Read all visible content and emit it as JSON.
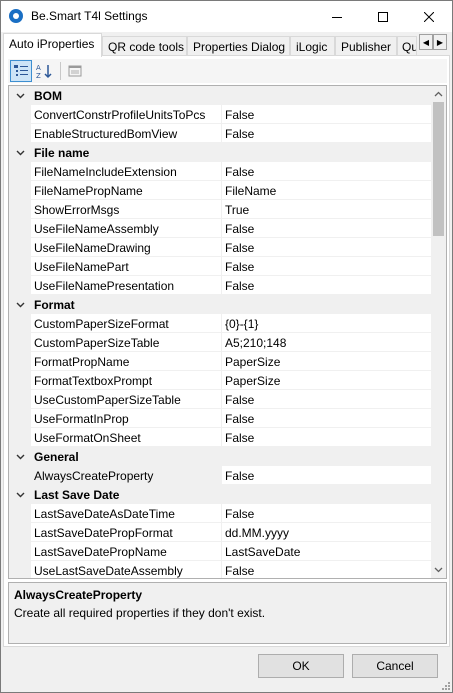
{
  "window": {
    "title": "Be.Smart T4l Settings"
  },
  "tabs": [
    {
      "label": "Auto iProperties"
    },
    {
      "label": "QR code tools"
    },
    {
      "label": "Properties Dialog"
    },
    {
      "label": "iLogic"
    },
    {
      "label": "Publisher"
    },
    {
      "label": "Qu"
    }
  ],
  "grid": {
    "categories": [
      {
        "name": "BOM",
        "properties": [
          {
            "name": "ConvertConstrProfileUnitsToPcs",
            "value": "False"
          },
          {
            "name": "EnableStructuredBomView",
            "value": "False"
          }
        ]
      },
      {
        "name": "File name",
        "properties": [
          {
            "name": "FileNameIncludeExtension",
            "value": "False"
          },
          {
            "name": "FileNamePropName",
            "value": "FileName"
          },
          {
            "name": "ShowErrorMsgs",
            "value": "True"
          },
          {
            "name": "UseFileNameAssembly",
            "value": "False"
          },
          {
            "name": "UseFileNameDrawing",
            "value": "False"
          },
          {
            "name": "UseFileNamePart",
            "value": "False"
          },
          {
            "name": "UseFileNamePresentation",
            "value": "False"
          }
        ]
      },
      {
        "name": "Format",
        "properties": [
          {
            "name": "CustomPaperSizeFormat",
            "value": "{0}-{1}"
          },
          {
            "name": "CustomPaperSizeTable",
            "value": "A5;210;148"
          },
          {
            "name": "FormatPropName",
            "value": "PaperSize"
          },
          {
            "name": "FormatTextboxPrompt",
            "value": "PaperSize"
          },
          {
            "name": "UseCustomPaperSizeTable",
            "value": "False"
          },
          {
            "name": "UseFormatInProp",
            "value": "False"
          },
          {
            "name": "UseFormatOnSheet",
            "value": "False"
          }
        ]
      },
      {
        "name": "General",
        "properties": [
          {
            "name": "AlwaysCreateProperty",
            "value": "False"
          }
        ]
      },
      {
        "name": "Last Save Date",
        "properties": [
          {
            "name": "LastSaveDateAsDateTime",
            "value": "False"
          },
          {
            "name": "LastSaveDatePropFormat",
            "value": "dd.MM.yyyy"
          },
          {
            "name": "LastSaveDatePropName",
            "value": "LastSaveDate"
          },
          {
            "name": "UseLastSaveDateAssembly",
            "value": "False"
          }
        ]
      }
    ]
  },
  "help": {
    "title": "AlwaysCreateProperty",
    "description": "Create all required properties if they don't exist."
  },
  "buttons": {
    "ok": "OK",
    "cancel": "Cancel"
  },
  "colors": {
    "accent": "#1a6fc4",
    "selection_border": "#3d8fd1"
  }
}
